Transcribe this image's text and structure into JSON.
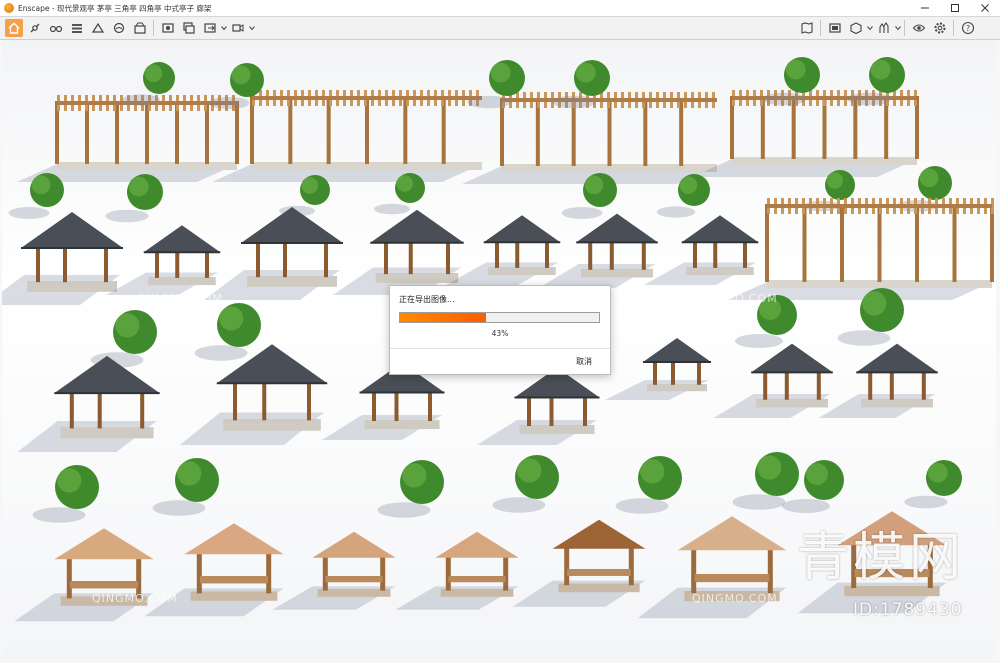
{
  "window": {
    "app_name": "Enscape",
    "title": "Enscape - 现代景观亭 茅亭 三角亭 四角亭 中式亭子 廊架"
  },
  "toolbar": {
    "left_icons": [
      "home-icon",
      "connect-icon",
      "glasses-icon",
      "views-icon",
      "sun-icon",
      "atmosphere-icon",
      "capture-icon",
      "screenshot-icon",
      "batch-render-icon",
      "export-icon"
    ],
    "right_icons": [
      "map-icon",
      "panorama-icon",
      "asset-library-icon",
      "material-icon",
      "vr-icon",
      "settings-icon",
      "help-icon"
    ],
    "active": "home-icon"
  },
  "dialog": {
    "title": "正在导出图像...",
    "progress": 0.43,
    "percent_label": "43%",
    "cancel_label": "取消"
  },
  "watermark": {
    "brand_cn": "青模网",
    "id_text": "ID:1789430",
    "small_text": "QINGMO.COM"
  },
  "colors": {
    "accent": "#f5a04a",
    "progress": "#ff7a00",
    "wood": "#c9965c",
    "roof_dark": "#4a4f57",
    "tree": "#3f8a2c"
  }
}
